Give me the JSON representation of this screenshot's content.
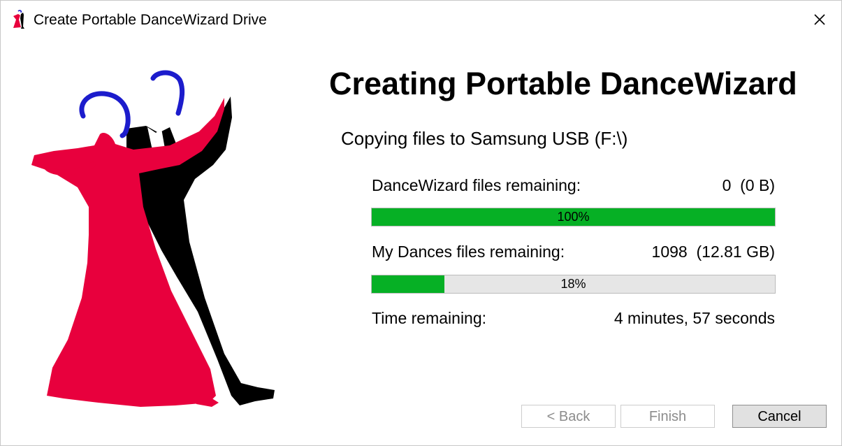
{
  "window": {
    "title": "Create Portable DanceWizard Drive"
  },
  "main": {
    "heading": "Creating Portable DanceWizard",
    "subheading": "Copying files to Samsung USB (F:\\)",
    "rows": [
      {
        "label": "DanceWizard files remaining:",
        "value": "0  (0 B)"
      },
      {
        "label": "My Dances files remaining:",
        "value": "1098  (12.81 GB)"
      },
      {
        "label": "Time remaining:",
        "value": "4 minutes, 57 seconds"
      }
    ],
    "progress": [
      {
        "percent_label": "100%",
        "fraction": 1.0
      },
      {
        "percent_label": "18%",
        "fraction": 0.18
      }
    ]
  },
  "buttons": {
    "back": "< Back",
    "finish": "Finish",
    "cancel": "Cancel"
  },
  "colors": {
    "progress_fill": "#06b025",
    "dress": "#e8003d",
    "suit": "#000000",
    "hair": "#1c1ccc"
  },
  "icons": {
    "app": "dancers-app-icon",
    "close": "close-icon"
  }
}
